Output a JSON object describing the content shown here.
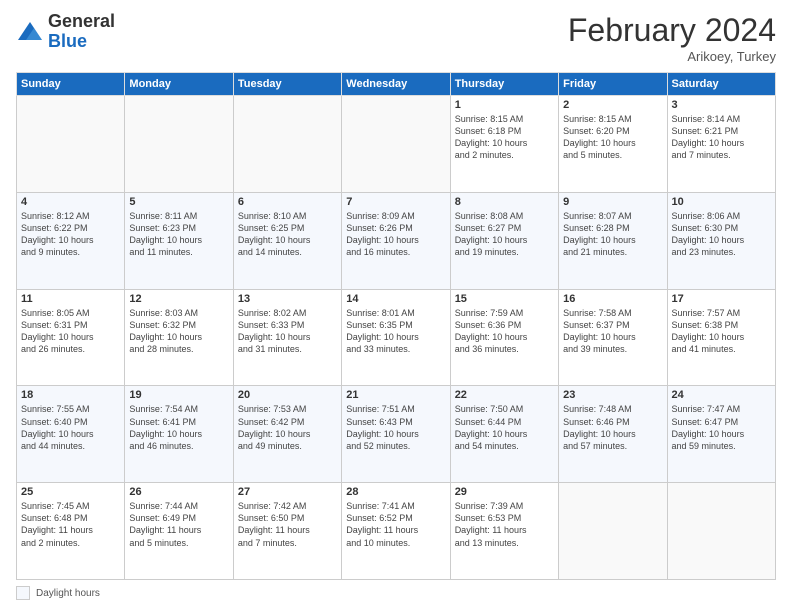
{
  "header": {
    "logo_general": "General",
    "logo_blue": "Blue",
    "month_title": "February 2024",
    "subtitle": "Arikoey, Turkey"
  },
  "columns": [
    "Sunday",
    "Monday",
    "Tuesday",
    "Wednesday",
    "Thursday",
    "Friday",
    "Saturday"
  ],
  "weeks": [
    [
      {
        "day": "",
        "info": ""
      },
      {
        "day": "",
        "info": ""
      },
      {
        "day": "",
        "info": ""
      },
      {
        "day": "",
        "info": ""
      },
      {
        "day": "1",
        "info": "Sunrise: 8:15 AM\nSunset: 6:18 PM\nDaylight: 10 hours\nand 2 minutes."
      },
      {
        "day": "2",
        "info": "Sunrise: 8:15 AM\nSunset: 6:20 PM\nDaylight: 10 hours\nand 5 minutes."
      },
      {
        "day": "3",
        "info": "Sunrise: 8:14 AM\nSunset: 6:21 PM\nDaylight: 10 hours\nand 7 minutes."
      }
    ],
    [
      {
        "day": "4",
        "info": "Sunrise: 8:12 AM\nSunset: 6:22 PM\nDaylight: 10 hours\nand 9 minutes."
      },
      {
        "day": "5",
        "info": "Sunrise: 8:11 AM\nSunset: 6:23 PM\nDaylight: 10 hours\nand 11 minutes."
      },
      {
        "day": "6",
        "info": "Sunrise: 8:10 AM\nSunset: 6:25 PM\nDaylight: 10 hours\nand 14 minutes."
      },
      {
        "day": "7",
        "info": "Sunrise: 8:09 AM\nSunset: 6:26 PM\nDaylight: 10 hours\nand 16 minutes."
      },
      {
        "day": "8",
        "info": "Sunrise: 8:08 AM\nSunset: 6:27 PM\nDaylight: 10 hours\nand 19 minutes."
      },
      {
        "day": "9",
        "info": "Sunrise: 8:07 AM\nSunset: 6:28 PM\nDaylight: 10 hours\nand 21 minutes."
      },
      {
        "day": "10",
        "info": "Sunrise: 8:06 AM\nSunset: 6:30 PM\nDaylight: 10 hours\nand 23 minutes."
      }
    ],
    [
      {
        "day": "11",
        "info": "Sunrise: 8:05 AM\nSunset: 6:31 PM\nDaylight: 10 hours\nand 26 minutes."
      },
      {
        "day": "12",
        "info": "Sunrise: 8:03 AM\nSunset: 6:32 PM\nDaylight: 10 hours\nand 28 minutes."
      },
      {
        "day": "13",
        "info": "Sunrise: 8:02 AM\nSunset: 6:33 PM\nDaylight: 10 hours\nand 31 minutes."
      },
      {
        "day": "14",
        "info": "Sunrise: 8:01 AM\nSunset: 6:35 PM\nDaylight: 10 hours\nand 33 minutes."
      },
      {
        "day": "15",
        "info": "Sunrise: 7:59 AM\nSunset: 6:36 PM\nDaylight: 10 hours\nand 36 minutes."
      },
      {
        "day": "16",
        "info": "Sunrise: 7:58 AM\nSunset: 6:37 PM\nDaylight: 10 hours\nand 39 minutes."
      },
      {
        "day": "17",
        "info": "Sunrise: 7:57 AM\nSunset: 6:38 PM\nDaylight: 10 hours\nand 41 minutes."
      }
    ],
    [
      {
        "day": "18",
        "info": "Sunrise: 7:55 AM\nSunset: 6:40 PM\nDaylight: 10 hours\nand 44 minutes."
      },
      {
        "day": "19",
        "info": "Sunrise: 7:54 AM\nSunset: 6:41 PM\nDaylight: 10 hours\nand 46 minutes."
      },
      {
        "day": "20",
        "info": "Sunrise: 7:53 AM\nSunset: 6:42 PM\nDaylight: 10 hours\nand 49 minutes."
      },
      {
        "day": "21",
        "info": "Sunrise: 7:51 AM\nSunset: 6:43 PM\nDaylight: 10 hours\nand 52 minutes."
      },
      {
        "day": "22",
        "info": "Sunrise: 7:50 AM\nSunset: 6:44 PM\nDaylight: 10 hours\nand 54 minutes."
      },
      {
        "day": "23",
        "info": "Sunrise: 7:48 AM\nSunset: 6:46 PM\nDaylight: 10 hours\nand 57 minutes."
      },
      {
        "day": "24",
        "info": "Sunrise: 7:47 AM\nSunset: 6:47 PM\nDaylight: 10 hours\nand 59 minutes."
      }
    ],
    [
      {
        "day": "25",
        "info": "Sunrise: 7:45 AM\nSunset: 6:48 PM\nDaylight: 11 hours\nand 2 minutes."
      },
      {
        "day": "26",
        "info": "Sunrise: 7:44 AM\nSunset: 6:49 PM\nDaylight: 11 hours\nand 5 minutes."
      },
      {
        "day": "27",
        "info": "Sunrise: 7:42 AM\nSunset: 6:50 PM\nDaylight: 11 hours\nand 7 minutes."
      },
      {
        "day": "28",
        "info": "Sunrise: 7:41 AM\nSunset: 6:52 PM\nDaylight: 11 hours\nand 10 minutes."
      },
      {
        "day": "29",
        "info": "Sunrise: 7:39 AM\nSunset: 6:53 PM\nDaylight: 11 hours\nand 13 minutes."
      },
      {
        "day": "",
        "info": ""
      },
      {
        "day": "",
        "info": ""
      }
    ]
  ],
  "footer": {
    "daylight_label": "Daylight hours"
  }
}
